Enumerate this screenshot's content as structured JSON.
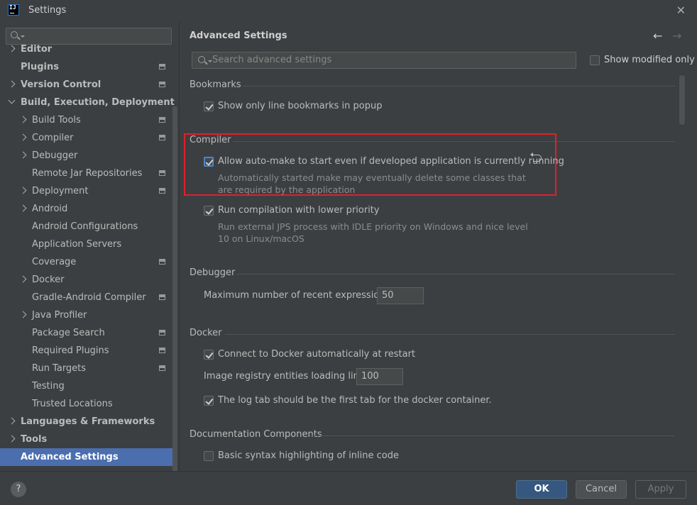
{
  "window": {
    "title": "Settings"
  },
  "sidebar": {
    "search_placeholder": "",
    "items": [
      {
        "label": "Editor",
        "level": 0,
        "arrow": "right",
        "bold": true,
        "project_icon": false,
        "selected": false
      },
      {
        "label": "Plugins",
        "level": 0,
        "arrow": "none",
        "bold": true,
        "project_icon": true,
        "selected": false
      },
      {
        "label": "Version Control",
        "level": 0,
        "arrow": "right",
        "bold": true,
        "project_icon": true,
        "selected": false
      },
      {
        "label": "Build, Execution, Deployment",
        "level": 0,
        "arrow": "down",
        "bold": true,
        "project_icon": false,
        "selected": false
      },
      {
        "label": "Build Tools",
        "level": 1,
        "arrow": "right",
        "bold": false,
        "project_icon": true,
        "selected": false
      },
      {
        "label": "Compiler",
        "level": 1,
        "arrow": "right",
        "bold": false,
        "project_icon": true,
        "selected": false
      },
      {
        "label": "Debugger",
        "level": 1,
        "arrow": "right",
        "bold": false,
        "project_icon": false,
        "selected": false
      },
      {
        "label": "Remote Jar Repositories",
        "level": 1,
        "arrow": "none",
        "bold": false,
        "project_icon": true,
        "selected": false
      },
      {
        "label": "Deployment",
        "level": 1,
        "arrow": "right",
        "bold": false,
        "project_icon": true,
        "selected": false
      },
      {
        "label": "Android",
        "level": 1,
        "arrow": "right",
        "bold": false,
        "project_icon": false,
        "selected": false
      },
      {
        "label": "Android Configurations",
        "level": 1,
        "arrow": "none",
        "bold": false,
        "project_icon": false,
        "selected": false
      },
      {
        "label": "Application Servers",
        "level": 1,
        "arrow": "none",
        "bold": false,
        "project_icon": false,
        "selected": false
      },
      {
        "label": "Coverage",
        "level": 1,
        "arrow": "none",
        "bold": false,
        "project_icon": true,
        "selected": false
      },
      {
        "label": "Docker",
        "level": 1,
        "arrow": "right",
        "bold": false,
        "project_icon": false,
        "selected": false
      },
      {
        "label": "Gradle-Android Compiler",
        "level": 1,
        "arrow": "none",
        "bold": false,
        "project_icon": true,
        "selected": false
      },
      {
        "label": "Java Profiler",
        "level": 1,
        "arrow": "right",
        "bold": false,
        "project_icon": false,
        "selected": false
      },
      {
        "label": "Package Search",
        "level": 1,
        "arrow": "none",
        "bold": false,
        "project_icon": true,
        "selected": false
      },
      {
        "label": "Required Plugins",
        "level": 1,
        "arrow": "none",
        "bold": false,
        "project_icon": true,
        "selected": false
      },
      {
        "label": "Run Targets",
        "level": 1,
        "arrow": "none",
        "bold": false,
        "project_icon": true,
        "selected": false
      },
      {
        "label": "Testing",
        "level": 1,
        "arrow": "none",
        "bold": false,
        "project_icon": false,
        "selected": false
      },
      {
        "label": "Trusted Locations",
        "level": 1,
        "arrow": "none",
        "bold": false,
        "project_icon": false,
        "selected": false
      },
      {
        "label": "Languages & Frameworks",
        "level": 0,
        "arrow": "right",
        "bold": true,
        "project_icon": false,
        "selected": false
      },
      {
        "label": "Tools",
        "level": 0,
        "arrow": "right",
        "bold": true,
        "project_icon": false,
        "selected": false
      },
      {
        "label": "Advanced Settings",
        "level": 0,
        "arrow": "none",
        "bold": true,
        "project_icon": false,
        "selected": true
      }
    ]
  },
  "main": {
    "title": "Advanced Settings",
    "search_placeholder": "Search advanced settings",
    "show_modified_label": "Show modified only",
    "show_modified_checked": false,
    "sections": {
      "bookmarks": {
        "title": "Bookmarks",
        "opt_line_bookmarks": {
          "label": "Show only line bookmarks in popup",
          "checked": true
        }
      },
      "compiler": {
        "title": "Compiler",
        "opt_auto_make": {
          "label": "Allow auto-make to start even if developed application is currently running",
          "checked": true,
          "desc1": "Automatically started make may eventually delete some classes that",
          "desc2": "are required by the application"
        },
        "opt_lower_priority": {
          "label": "Run compilation with lower priority",
          "checked": true,
          "desc1": "Run external JPS process with IDLE priority on Windows and nice level",
          "desc2": "10 on Linux/macOS"
        }
      },
      "debugger": {
        "title": "Debugger",
        "max_expr_label": "Maximum number of recent expressions:",
        "max_expr_value": "50"
      },
      "docker": {
        "title": "Docker",
        "opt_connect": {
          "label": "Connect to Docker automatically at restart",
          "checked": true
        },
        "registry_label": "Image registry entities loading limit:",
        "registry_value": "100",
        "opt_log_tab": {
          "label": "The log tab should be the first tab for the docker container.",
          "checked": true
        }
      },
      "documentation": {
        "title": "Documentation Components",
        "opt_syntax": {
          "label": "Basic syntax highlighting of inline code",
          "checked": false
        }
      }
    }
  },
  "buttons": {
    "help": "?",
    "ok": "OK",
    "cancel": "Cancel",
    "apply": "Apply"
  },
  "colors": {
    "background": "#3c3f41",
    "selection": "#4b6eaf",
    "highlight_box": "#e0202a",
    "ok_button": "#365880"
  }
}
